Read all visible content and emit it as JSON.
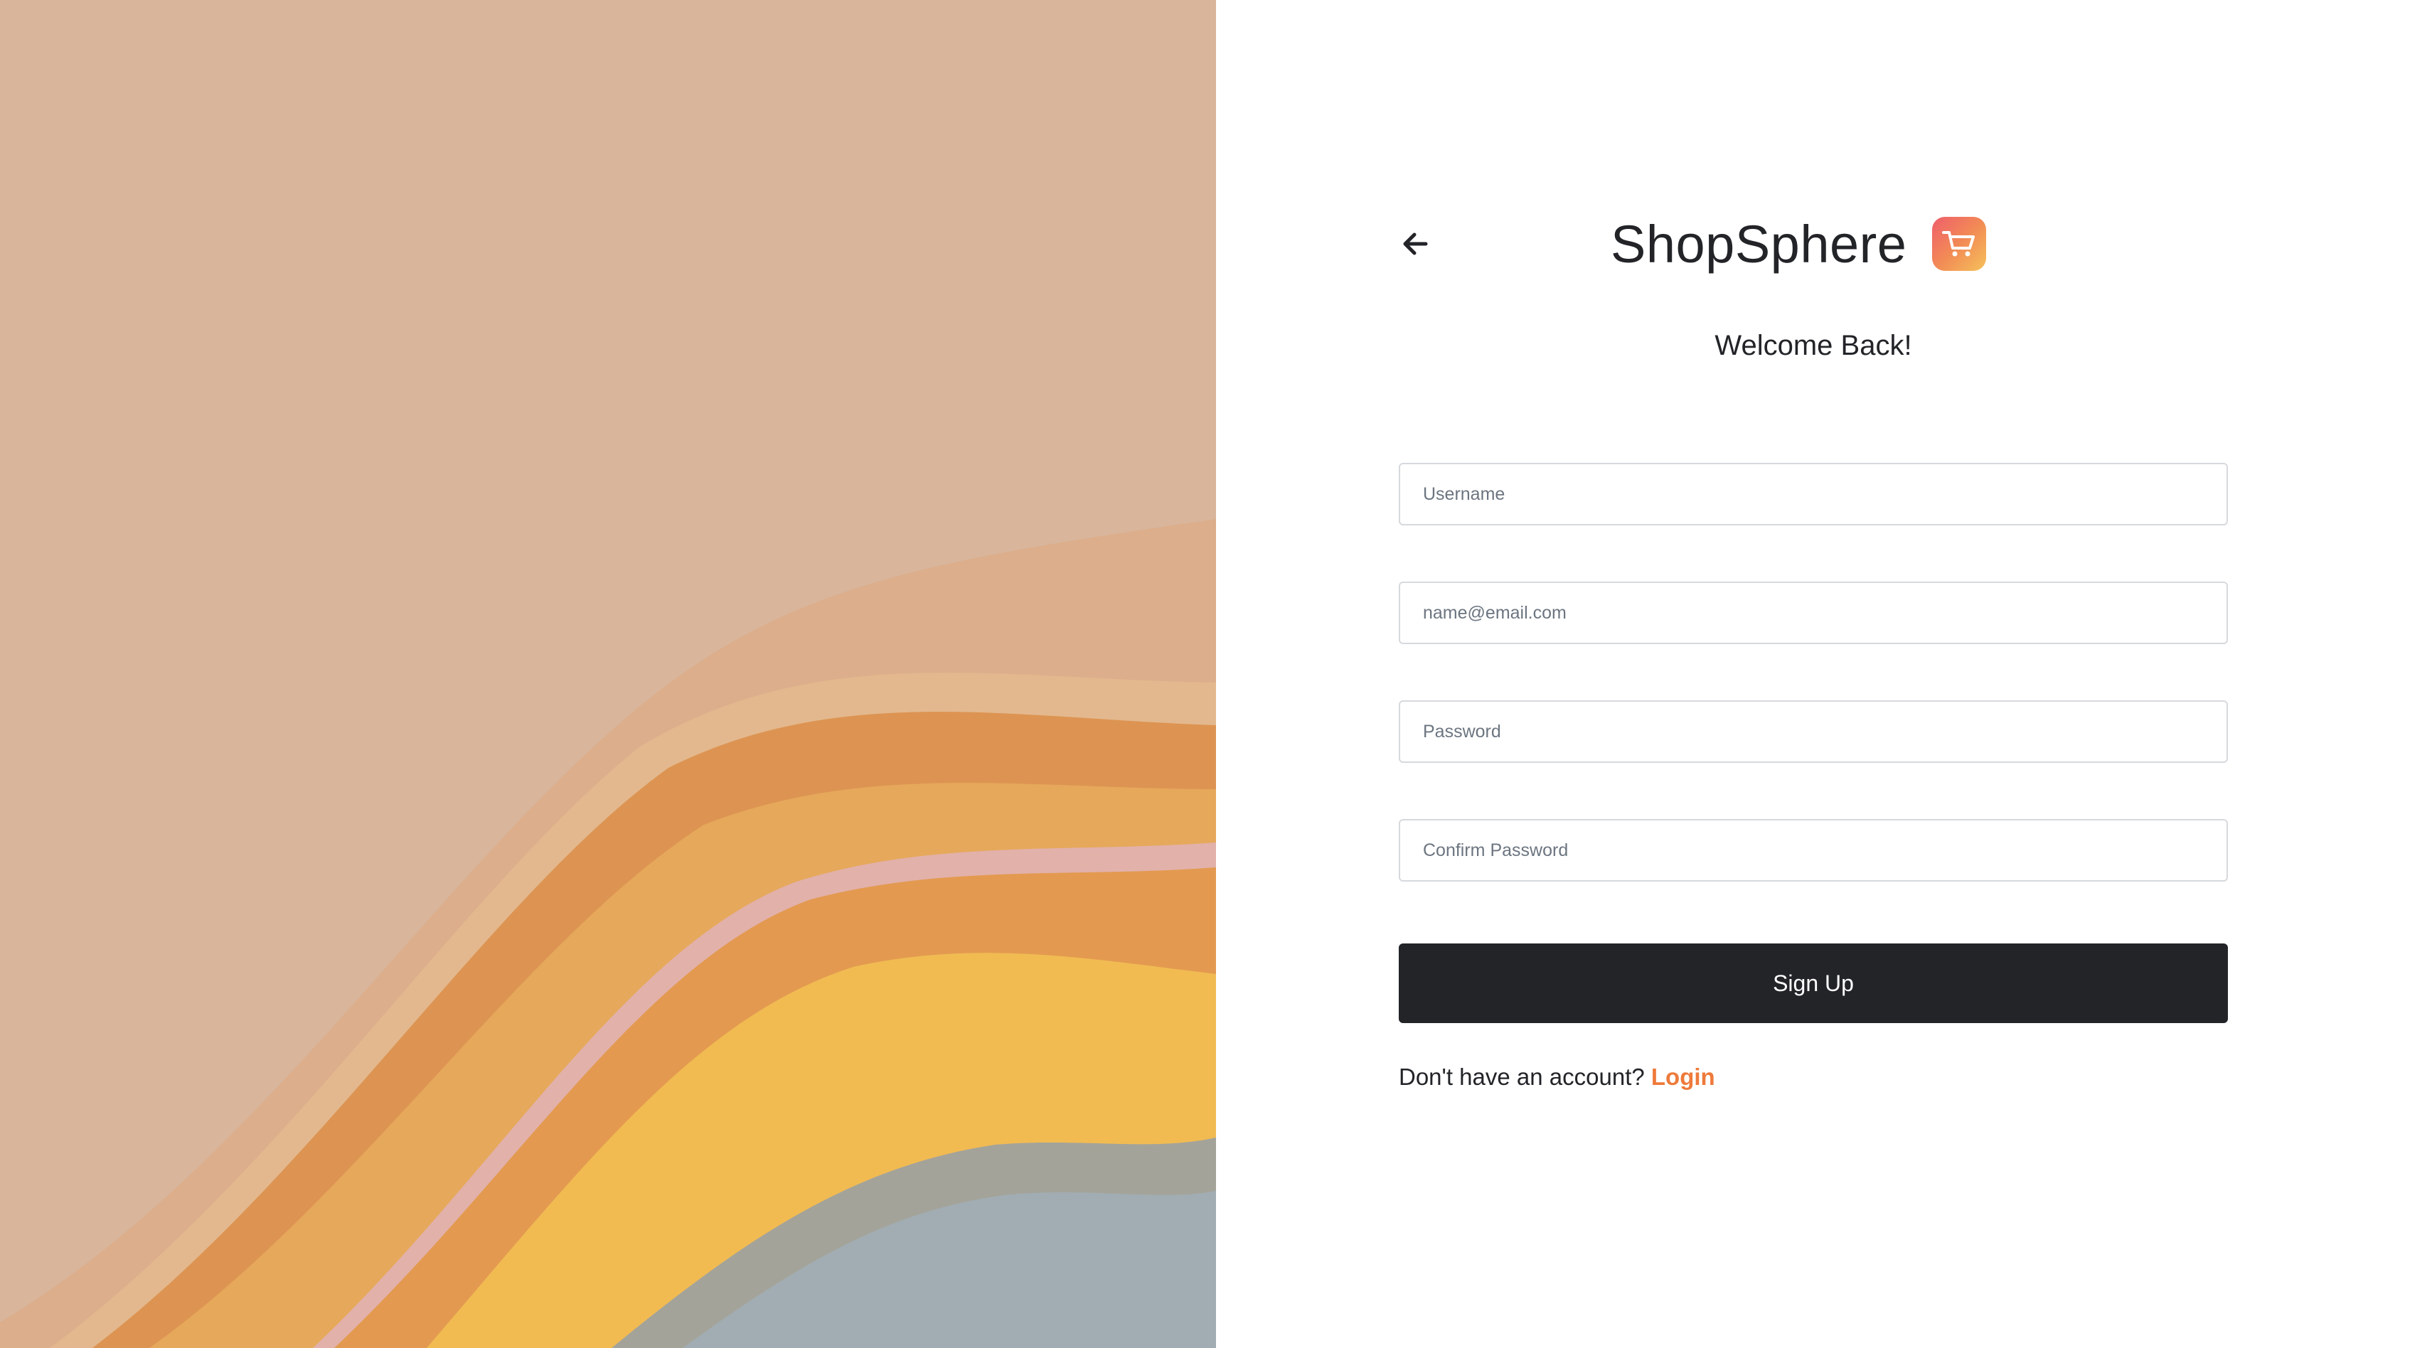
{
  "brand": {
    "name": "ShopSphere",
    "logo_icon": "shopping-cart-icon",
    "accent_color": "#ee7a3b"
  },
  "form": {
    "heading": "Welcome Back!",
    "username_placeholder": "Username",
    "email_placeholder": "name@email.com",
    "password_placeholder": "Password",
    "confirm_password_placeholder": "Confirm Password",
    "submit_label": "Sign Up",
    "account_prompt": "Don't have an account?",
    "login_link_label": "Login"
  },
  "nav": {
    "back_icon": "arrow-left-icon"
  },
  "colors": {
    "button_bg": "#222428",
    "link": "#ee7a3b",
    "field_border": "#d6d9dd"
  }
}
